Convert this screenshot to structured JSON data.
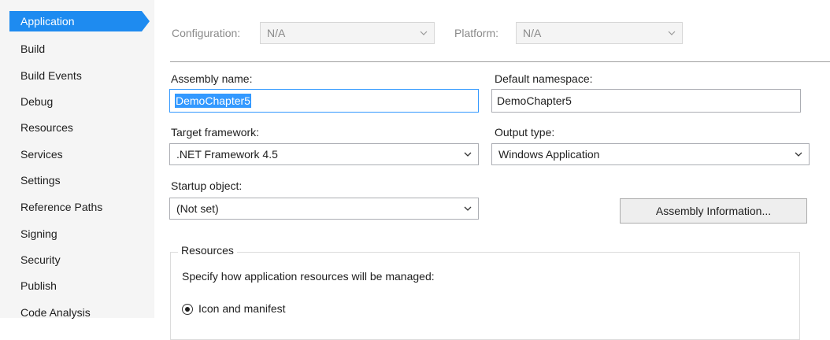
{
  "sidebar": {
    "items": [
      {
        "label": "Application",
        "active": true
      },
      {
        "label": "Build"
      },
      {
        "label": "Build Events"
      },
      {
        "label": "Debug"
      },
      {
        "label": "Resources"
      },
      {
        "label": "Services"
      },
      {
        "label": "Settings"
      },
      {
        "label": "Reference Paths"
      },
      {
        "label": "Signing"
      },
      {
        "label": "Security"
      },
      {
        "label": "Publish"
      },
      {
        "label": "Code Analysis"
      }
    ]
  },
  "config_bar": {
    "configuration_label": "Configuration:",
    "configuration_value": "N/A",
    "platform_label": "Platform:",
    "platform_value": "N/A"
  },
  "form": {
    "assembly_name_label": "Assembly name:",
    "assembly_name_value": "DemoChapter5",
    "default_namespace_label": "Default namespace:",
    "default_namespace_value": "DemoChapter5",
    "target_framework_label": "Target framework:",
    "target_framework_value": ".NET Framework 4.5",
    "output_type_label": "Output type:",
    "output_type_value": "Windows Application",
    "startup_object_label": "Startup object:",
    "startup_object_value": "(Not set)",
    "assembly_info_button": "Assembly Information..."
  },
  "resources": {
    "title": "Resources",
    "description": "Specify how application resources will be managed:",
    "icon_manifest_label": "Icon and manifest",
    "icon_manifest_selected": true
  },
  "colors": {
    "accent": "#1e8bf0",
    "selection": "#3399ff",
    "sidebar_bg": "#f5f5f5"
  }
}
